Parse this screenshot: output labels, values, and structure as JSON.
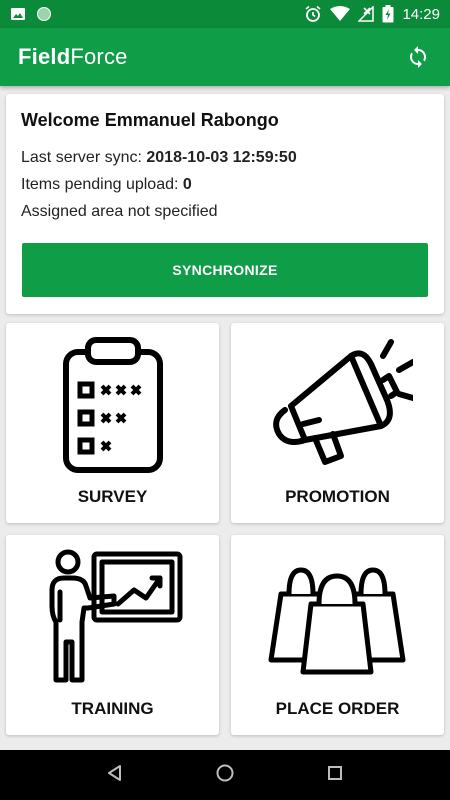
{
  "status_bar": {
    "time": "14:29",
    "icons": [
      "image-icon",
      "circle-icon",
      "alarm-icon",
      "wifi-icon",
      "no-signal-icon",
      "battery-icon"
    ]
  },
  "app_bar": {
    "title_bold": "Field",
    "title_light": "Force",
    "action_icon": "sync-icon"
  },
  "welcome_card": {
    "greeting": "Welcome Emmanuel Rabongo",
    "last_sync_label": "Last server sync: ",
    "last_sync_value": "2018-10-03 12:59:50",
    "pending_label": "Items pending upload: ",
    "pending_value": "0",
    "area_text": "Assigned area not specified",
    "sync_button": "SYNCHRONIZE"
  },
  "tiles": [
    {
      "label": "SURVEY",
      "icon": "clipboard-icon"
    },
    {
      "label": "PROMOTION",
      "icon": "megaphone-icon"
    },
    {
      "label": "TRAINING",
      "icon": "presentation-icon"
    },
    {
      "label": "PLACE ORDER",
      "icon": "shopping-bags-icon"
    }
  ],
  "nav_bar": {
    "icons": [
      "back-icon",
      "home-icon",
      "recents-icon"
    ]
  },
  "colors": {
    "status_bar": "#0b8a3a",
    "primary": "#0f9d48",
    "background": "#ececec"
  }
}
